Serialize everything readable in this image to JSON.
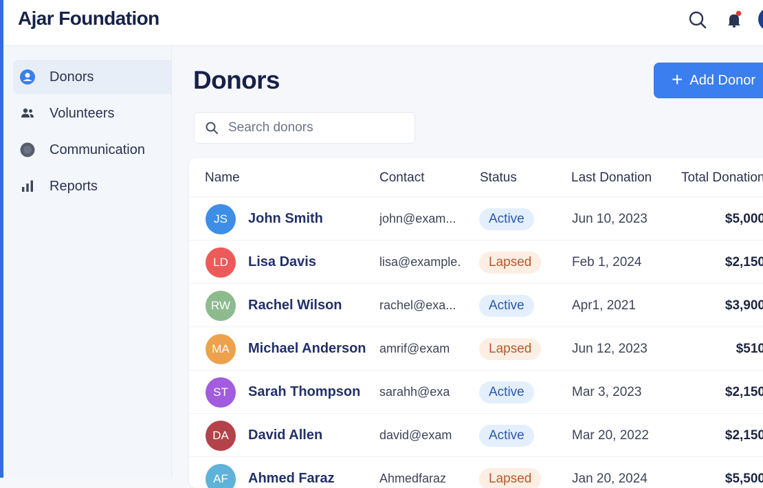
{
  "app": {
    "title": "Ajar Foundation"
  },
  "sidebar": {
    "items": [
      {
        "label": "Donors",
        "icon": "user-circle-icon",
        "active": true
      },
      {
        "label": "Volunteers",
        "icon": "users-icon",
        "active": false
      },
      {
        "label": "Communication",
        "icon": "circle-icon",
        "active": false
      },
      {
        "label": "Reports",
        "icon": "bar-chart-icon",
        "active": false
      }
    ]
  },
  "main": {
    "title": "Donors",
    "add_button_label": "Add Donor",
    "search": {
      "placeholder": "Search donors",
      "value": ""
    }
  },
  "table": {
    "columns": [
      "Name",
      "Contact",
      "Status",
      "Last Donation",
      "Total Donations"
    ],
    "rows": [
      {
        "initials": "JS",
        "name": "John Smith",
        "contact": "john@exam...",
        "status": "Active",
        "last_donation": "Jun 10, 2023",
        "total": "$5,000",
        "avatar_color": "#3d8ee6"
      },
      {
        "initials": "LD",
        "name": "Lisa Davis",
        "contact": "lisa@example.",
        "status": "Lapsed",
        "last_donation": "Feb 1, 2024",
        "total": "$2,150",
        "avatar_color": "#ee5a5a"
      },
      {
        "initials": "RW",
        "name": "Rachel Wilson",
        "contact": "rachel@exa...",
        "status": "Active",
        "last_donation": "Apr1, 2021",
        "total": "$3,900",
        "avatar_color": "#8dbb8e"
      },
      {
        "initials": "MA",
        "name": "Michael Anderson",
        "contact": "amrif@exam",
        "status": "Lapsed",
        "last_donation": "Jun 12, 2023",
        "total": "$510",
        "avatar_color": "#eda14d"
      },
      {
        "initials": "ST",
        "name": "Sarah Thompson",
        "contact": "sarahh@exa",
        "status": "Active",
        "last_donation": "Mar 3, 2023",
        "total": "$2,150",
        "avatar_color": "#a25ce0"
      },
      {
        "initials": "DA",
        "name": "David Allen",
        "contact": "david@exam",
        "status": "Active",
        "last_donation": "Mar 20, 2022",
        "total": "$2,150",
        "avatar_color": "#b4424a"
      },
      {
        "initials": "AF",
        "name": "Ahmed Faraz",
        "contact": "Ahmedfaraz",
        "status": "Lapsed",
        "last_donation": "Jan 20, 2024",
        "total": "$5,500",
        "avatar_color": "#5fb2d8"
      }
    ]
  },
  "colors": {
    "accent": "#3a7ef0",
    "brand_dark": "#17224a",
    "active_badge": "#e3effd",
    "lapsed_badge": "#fdeee3"
  }
}
